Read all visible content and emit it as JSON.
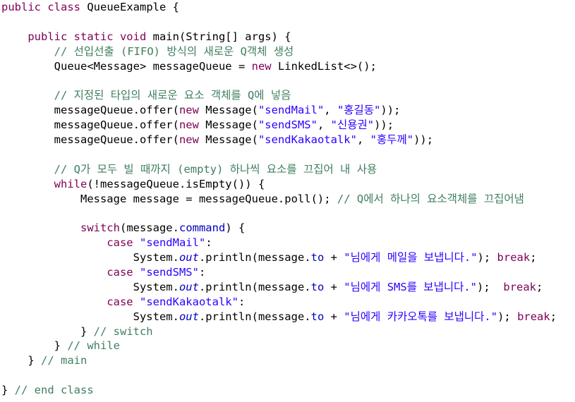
{
  "colors": {
    "background": "#ffffff",
    "keyword": "#7f0055",
    "comment": "#3f7f5f",
    "string": "#2a00ff",
    "field": "#0000c0",
    "plain": "#000000"
  },
  "code_lines": [
    [
      {
        "t": "public class ",
        "c": "keyword"
      },
      {
        "t": "QueueExample {",
        "c": "plain"
      }
    ],
    [],
    [
      {
        "t": "    ",
        "c": "plain"
      },
      {
        "t": "public static void",
        "c": "keyword"
      },
      {
        "t": " main(String[] args) {",
        "c": "plain"
      }
    ],
    [
      {
        "t": "        ",
        "c": "plain"
      },
      {
        "t": "// 선입선출 (FIFO) 방식의 새로운 Q객체 생성",
        "c": "comment"
      }
    ],
    [
      {
        "t": "        Queue<Message> messageQueue = ",
        "c": "plain"
      },
      {
        "t": "new",
        "c": "keyword"
      },
      {
        "t": " LinkedList<>();",
        "c": "plain"
      }
    ],
    [],
    [
      {
        "t": "        ",
        "c": "plain"
      },
      {
        "t": "// 지정된 타입의 새로운 요소 객체를 Q에 넣음",
        "c": "comment"
      }
    ],
    [
      {
        "t": "        messageQueue.offer(",
        "c": "plain"
      },
      {
        "t": "new",
        "c": "keyword"
      },
      {
        "t": " Message(",
        "c": "plain"
      },
      {
        "t": "\"sendMail\"",
        "c": "string"
      },
      {
        "t": ", ",
        "c": "plain"
      },
      {
        "t": "\"홍길동\"",
        "c": "string"
      },
      {
        "t": "));",
        "c": "plain"
      }
    ],
    [
      {
        "t": "        messageQueue.offer(",
        "c": "plain"
      },
      {
        "t": "new",
        "c": "keyword"
      },
      {
        "t": " Message(",
        "c": "plain"
      },
      {
        "t": "\"sendSMS\"",
        "c": "string"
      },
      {
        "t": ", ",
        "c": "plain"
      },
      {
        "t": "\"신용권\"",
        "c": "string"
      },
      {
        "t": "));",
        "c": "plain"
      }
    ],
    [
      {
        "t": "        messageQueue.offer(",
        "c": "plain"
      },
      {
        "t": "new",
        "c": "keyword"
      },
      {
        "t": " Message(",
        "c": "plain"
      },
      {
        "t": "\"sendKakaotalk\"",
        "c": "string"
      },
      {
        "t": ", ",
        "c": "plain"
      },
      {
        "t": "\"홍두께\"",
        "c": "string"
      },
      {
        "t": "));",
        "c": "plain"
      }
    ],
    [],
    [
      {
        "t": "        ",
        "c": "plain"
      },
      {
        "t": "// Q가 모두 빌 때까지 (empty) 하나씩 요소를 끄집어 내 사용",
        "c": "comment"
      }
    ],
    [
      {
        "t": "        ",
        "c": "plain"
      },
      {
        "t": "while",
        "c": "keyword"
      },
      {
        "t": "(!messageQueue.isEmpty()) {",
        "c": "plain"
      }
    ],
    [
      {
        "t": "            Message message = messageQueue.poll(); ",
        "c": "plain"
      },
      {
        "t": "// Q에서 하나의 요소객체를 끄집어냄",
        "c": "comment"
      }
    ],
    [],
    [
      {
        "t": "            ",
        "c": "plain"
      },
      {
        "t": "switch",
        "c": "keyword"
      },
      {
        "t": "(message.",
        "c": "plain"
      },
      {
        "t": "command",
        "c": "field"
      },
      {
        "t": ") {",
        "c": "plain"
      }
    ],
    [
      {
        "t": "                ",
        "c": "plain"
      },
      {
        "t": "case",
        "c": "keyword"
      },
      {
        "t": " ",
        "c": "plain"
      },
      {
        "t": "\"sendMail\"",
        "c": "string"
      },
      {
        "t": ":",
        "c": "plain"
      }
    ],
    [
      {
        "t": "                    System.",
        "c": "plain"
      },
      {
        "t": "out",
        "c": "static"
      },
      {
        "t": ".println(message.",
        "c": "plain"
      },
      {
        "t": "to",
        "c": "field"
      },
      {
        "t": " + ",
        "c": "plain"
      },
      {
        "t": "\"님에게 메일을 보냅니다.\"",
        "c": "string"
      },
      {
        "t": "); ",
        "c": "plain"
      },
      {
        "t": "break",
        "c": "keyword"
      },
      {
        "t": ";",
        "c": "plain"
      }
    ],
    [
      {
        "t": "                ",
        "c": "plain"
      },
      {
        "t": "case",
        "c": "keyword"
      },
      {
        "t": " ",
        "c": "plain"
      },
      {
        "t": "\"sendSMS\"",
        "c": "string"
      },
      {
        "t": ":",
        "c": "plain"
      }
    ],
    [
      {
        "t": "                    System.",
        "c": "plain"
      },
      {
        "t": "out",
        "c": "static"
      },
      {
        "t": ".println(message.",
        "c": "plain"
      },
      {
        "t": "to",
        "c": "field"
      },
      {
        "t": " + ",
        "c": "plain"
      },
      {
        "t": "\"님에게 SMS를 보냅니다.\"",
        "c": "string"
      },
      {
        "t": ");  ",
        "c": "plain"
      },
      {
        "t": "break",
        "c": "keyword"
      },
      {
        "t": ";",
        "c": "plain"
      }
    ],
    [
      {
        "t": "                ",
        "c": "plain"
      },
      {
        "t": "case",
        "c": "keyword"
      },
      {
        "t": " ",
        "c": "plain"
      },
      {
        "t": "\"sendKakaotalk\"",
        "c": "string"
      },
      {
        "t": ":",
        "c": "plain"
      }
    ],
    [
      {
        "t": "                    System.",
        "c": "plain"
      },
      {
        "t": "out",
        "c": "static"
      },
      {
        "t": ".println(message.",
        "c": "plain"
      },
      {
        "t": "to",
        "c": "field"
      },
      {
        "t": " + ",
        "c": "plain"
      },
      {
        "t": "\"님에게 카카오톡를 보냅니다.\"",
        "c": "string"
      },
      {
        "t": "); ",
        "c": "plain"
      },
      {
        "t": "break",
        "c": "keyword"
      },
      {
        "t": ";",
        "c": "plain"
      }
    ],
    [
      {
        "t": "            } ",
        "c": "plain"
      },
      {
        "t": "// switch",
        "c": "comment"
      }
    ],
    [
      {
        "t": "        } ",
        "c": "plain"
      },
      {
        "t": "// while",
        "c": "comment"
      }
    ],
    [
      {
        "t": "    } ",
        "c": "plain"
      },
      {
        "t": "// main",
        "c": "comment"
      }
    ],
    [],
    [
      {
        "t": "} ",
        "c": "plain"
      },
      {
        "t": "// end class",
        "c": "comment"
      }
    ]
  ]
}
